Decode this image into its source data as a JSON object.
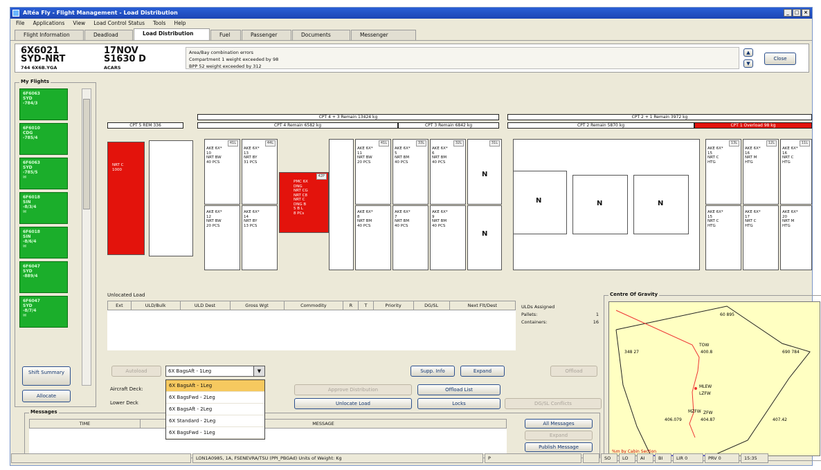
{
  "window": {
    "title": "Altéa Fly - Flight Management - Load Distribution"
  },
  "menu": [
    "File",
    "Applications",
    "View",
    "Load Control Status",
    "Tools",
    "Help"
  ],
  "tabs": [
    "Flight Information",
    "Deadload",
    "Load Distribution",
    "Fuel",
    "Passenger",
    "Documents",
    "Messenger"
  ],
  "flight": {
    "number": "6X6021",
    "route": "SYD-NRT",
    "aircraft": "744 6X6B.YGA",
    "date": "17NOV",
    "dep": "S1630 D",
    "acars": "ACARS"
  },
  "errors": {
    "heading": "Area/Bay combination errors",
    "lines": [
      "Compartment 1 weight exceeded by 98",
      "BPP 52 weight exceeded by 312"
    ]
  },
  "close_label": "Close",
  "my_flights": {
    "title": "My Flights",
    "items": [
      {
        "l1": "6F6063",
        "l2": "SYD",
        "l3": "-784/3"
      },
      {
        "l1": "6F6010",
        "l2": "CDG",
        "l3": "-785/4"
      },
      {
        "l1": "6F6063",
        "l2": "SYD",
        "l3": "-785/5"
      },
      {
        "l1": "6F6018",
        "l2": "SIN",
        "l3": "-8/3/4"
      },
      {
        "l1": "6F6018",
        "l2": "SIN",
        "l3": "-8/6/4"
      },
      {
        "l1": "6F6047",
        "l2": "SYD",
        "l3": "-889/4"
      },
      {
        "l1": "6F6047",
        "l2": "SYD",
        "l3": "-8/7/4"
      }
    ]
  },
  "left_buttons": {
    "shift": "Shift Summary",
    "allocate": "Allocate"
  },
  "holds": {
    "cpt5": "CPT 5 REM 336",
    "cpt43": "CPT 4 + 3 Remain 13424 kg",
    "cpt4": "CPT 4 Remain 6582 kg",
    "cpt3": "CPT 3 Remain 6842 kg",
    "cpt21": "CPT 2 + 1 Remain 3972 kg",
    "cpt2": "CPT 2 Remain 5870 kg",
    "cpt1": "CPT 1 Overload 98 kg"
  },
  "positions": {
    "red_main": "NRT C\n1000",
    "red_mid": "PMC 6X\nDNG\nNRT CG\nNRT C8\nNRT C\nDNG B\n5 B L\n8 PCs",
    "ake1": "AKE 6X*\n10\nNRT BW\n40 PCS",
    "ake2": "AKE 6X*\n13\nNRT BY\n31 PCS",
    "ake3": "AKE 6X*\n11\nNRT BW\n20 PCS",
    "ake4": "AKE 6X*\n5\nNRT BM\n40 PCS",
    "ake5": "AKE 6X*\n6\nNRT BM\n40 PCS",
    "ake6": "AKE 6X*\n12\nNRT BW\n20 PCS",
    "ake7": "AKE 6X*\n14\nNRT BY\n13 PCS",
    "ake8": "AKE 6X*\n8\nNRT BM\n40 PCS",
    "ake9": "AKE 6X*\n7\nNRT BM\n40 PCS",
    "ake10": "AKE 6X*\n9\nNRT BM\n40 PCS",
    "ake11": "AKE 6X*\n15\nNRT C\nHTG",
    "ake12": "AKE 6X*\n16\nNRT M\nHTG",
    "ake13": "AKE 6X*\n16\nNRT C\nHTG",
    "ake14": "AKE 6X*\n15\nNRT C\nHTG",
    "ake15": "AKE 6X*\n17\nNRT C\nHTG",
    "ake16": "AKE 6X*\n20\nNRT M\nHTG",
    "n": "N"
  },
  "unlocated": {
    "title": "Unlocated Load",
    "columns": [
      "Ext",
      "ULD/Bulk",
      "ULD Dest",
      "Gross Wgt",
      "Commodity",
      "R",
      "T",
      "Priority",
      "DG/SL",
      "Next Flt/Dest"
    ],
    "assigned_title": "ULDs Assigned",
    "pallets_label": "Pallets:",
    "pallets_value": "1",
    "containers_label": "Containers:",
    "containers_value": "16"
  },
  "controls": {
    "autoload": "Autoload",
    "combo_value": "6X BagsAft - 1Leg",
    "supp_info": "Supp. Info",
    "expand": "Expand",
    "offload": "Offload",
    "aircraft_deck": "Aircraft Deck:",
    "lower_deck": "Lower Deck",
    "approve": "Approve Distribution",
    "offload_list": "Offload List",
    "unlocate": "Unlocate Load",
    "locks": "Locks",
    "dgsl": "DG/SL Conflicts"
  },
  "dropdown": [
    "6X BagsAft - 1Leg",
    "6X BagsFwd - 2Leg",
    "6X BagsAft - 2Leg",
    "6X Standard - 2Leg",
    "6X BagsFwd - 1Leg"
  ],
  "messages": {
    "title": "Messages",
    "time_col": "TIME",
    "msg_col": "MESSAGE",
    "all": "All Messages",
    "expand": "Expand",
    "publish": "Publish Message"
  },
  "cog": {
    "title": "Centre Of Gravity",
    "labels": {
      "top": "60 895",
      "left": "348 27",
      "right": "690 784",
      "tow": "TOW",
      "tow_v": "400.8",
      "mlew": "MLEW",
      "lzfw": "LZFW",
      "mzfw": "MZFW",
      "zfw": "ZFW",
      "b1": "406.079",
      "b2": "404.87",
      "b3": "407.42",
      "foot": "%m by Cabin Section"
    }
  },
  "status": [
    "",
    "LON1A0985, 1A, FSENEVRA/TSU (PPI_PBGAd) Units of Weight: Kg",
    "P",
    "",
    "SO",
    "LO",
    "AI",
    "BI",
    "LIR 0",
    "PRV 0",
    "15:35"
  ]
}
